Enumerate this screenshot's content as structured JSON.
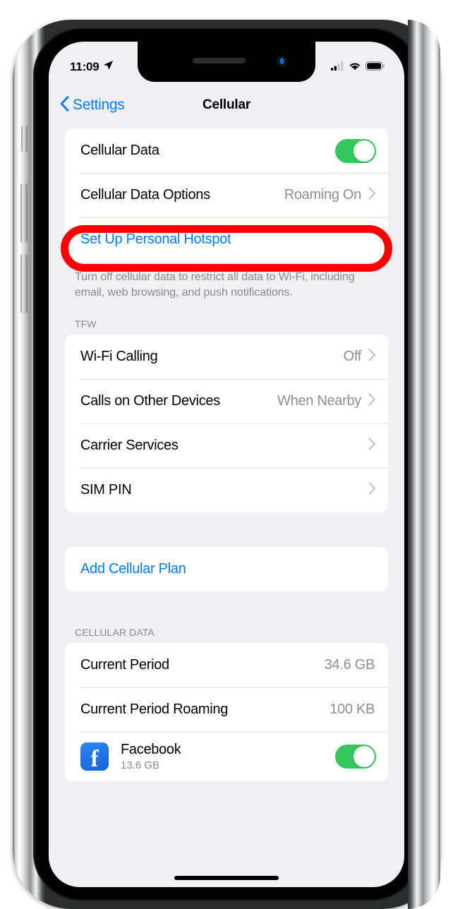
{
  "status_bar": {
    "time": "11:09",
    "location_icon": "location-arrow-icon",
    "cellular_icon": "cellular-signal-icon",
    "wifi_icon": "wifi-icon",
    "battery_icon": "battery-full-icon",
    "signal_bars_filled": 2,
    "signal_bars_total": 4
  },
  "nav": {
    "back_label": "Settings",
    "title": "Cellular"
  },
  "group_cellular": {
    "rows": [
      {
        "label": "Cellular Data",
        "value": "",
        "control": "toggle",
        "toggle_on": true
      },
      {
        "label": "Cellular Data Options",
        "value": "Roaming On",
        "control": "chevron",
        "highlighted": true
      },
      {
        "label": "Set Up Personal Hotspot",
        "value": "",
        "control": "none",
        "link": true
      }
    ],
    "footer": "Turn off cellular data to restrict all data to Wi-Fi, including email, web browsing, and push notifications."
  },
  "group_carrier": {
    "header": "TFW",
    "rows": [
      {
        "label": "Wi-Fi Calling",
        "value": "Off",
        "control": "chevron"
      },
      {
        "label": "Calls on Other Devices",
        "value": "When Nearby",
        "control": "chevron"
      },
      {
        "label": "Carrier Services",
        "value": "",
        "control": "chevron"
      },
      {
        "label": "SIM PIN",
        "value": "",
        "control": "chevron"
      }
    ]
  },
  "group_plan": {
    "rows": [
      {
        "label": "Add Cellular Plan",
        "value": "",
        "control": "none",
        "link": true
      }
    ]
  },
  "group_data": {
    "header": "CELLULAR DATA",
    "rows": [
      {
        "label": "Current Period",
        "value": "34.6 GB",
        "control": "none"
      },
      {
        "label": "Current Period Roaming",
        "value": "100 KB",
        "control": "none"
      }
    ],
    "apps": [
      {
        "name": "Facebook",
        "size": "13.6 GB",
        "icon": "facebook-icon",
        "toggle_on": true
      }
    ]
  },
  "annotation": {
    "type": "red-oval-highlight",
    "target": "Cellular Data Options",
    "color": "#ff0000"
  },
  "colors": {
    "accent_blue": "#007aff",
    "toggle_green": "#34c759",
    "secondary_text": "#8e8e93",
    "background": "#f0eff4",
    "card": "#ffffff",
    "facebook_blue": "#1877f2"
  },
  "device": {
    "home_indicator": "home-indicator",
    "notch": "notch",
    "buttons": [
      "mute-switch",
      "volume-up",
      "volume-down",
      "power-button"
    ]
  }
}
